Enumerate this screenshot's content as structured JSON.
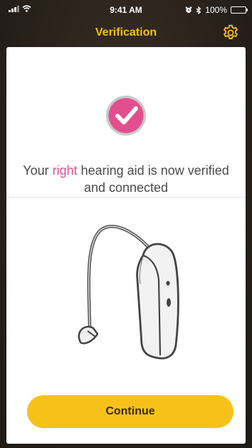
{
  "status_bar": {
    "time": "9:41 AM",
    "battery": "100%"
  },
  "nav": {
    "title": "Verification",
    "settings_icon": "gear-icon"
  },
  "message": {
    "before": "Your ",
    "highlight": "right",
    "after": " hearing aid is now verified and connected"
  },
  "icons": {
    "status": "check-circle-icon",
    "illustration": "hearing-aid-illustration"
  },
  "colors": {
    "accent": "#f6c21a",
    "title": "#f5bf17",
    "check": "#e34f8e",
    "highlight": "#e34f8e"
  },
  "continue_label": "Continue"
}
